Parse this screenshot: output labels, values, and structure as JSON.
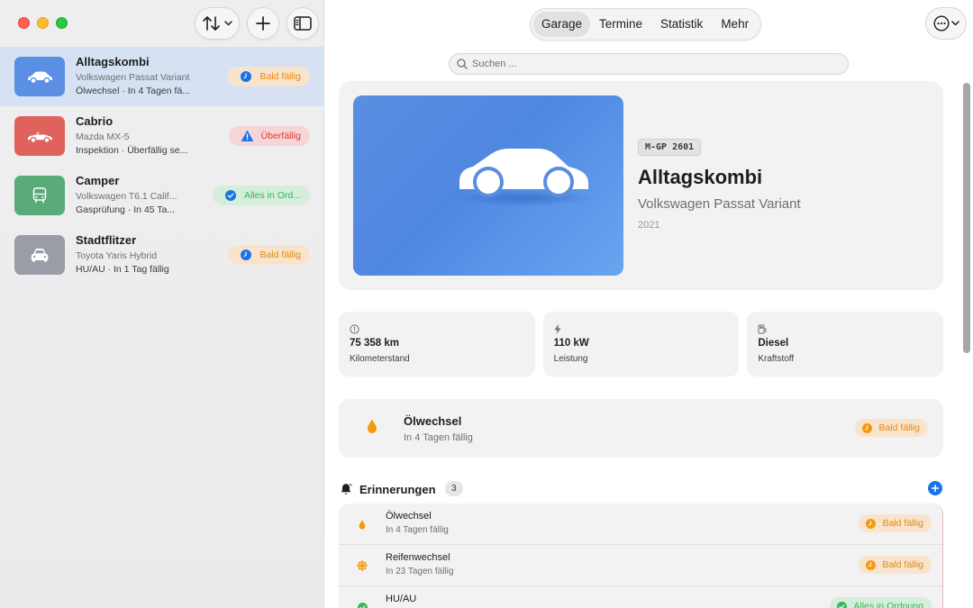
{
  "sidebar": {
    "vehicles": [
      {
        "name": "Alltagskombi",
        "model": "Volkswagen Passat Variant",
        "status": "Ölwechsel · In 4 Tagen fä...",
        "badge": "Bald fällig",
        "badge_type": "soon",
        "thumb_color": "#5b8fe3",
        "icon": "car-icon",
        "active": true
      },
      {
        "name": "Cabrio",
        "model": "Mazda MX-5",
        "status": "Inspektion · Überfällig se...",
        "badge": "Überfällig",
        "badge_type": "over",
        "thumb_color": "#e0625d",
        "icon": "convertible-icon",
        "active": false
      },
      {
        "name": "Camper",
        "model": "Volkswagen T6.1 Calif...",
        "status": "Gasprüfung · In 45 Ta...",
        "badge": "Alles in Ord...",
        "badge_type": "ok",
        "thumb_color": "#5aab78",
        "icon": "bus-icon",
        "active": false
      },
      {
        "name": "Stadtflitzer",
        "model": "Toyota Yaris Hybrid",
        "status": "HU/AU · In 1 Tag fällig",
        "badge": "Bald fällig",
        "badge_type": "soon",
        "thumb_color": "#9a9ca6",
        "icon": "car-front-icon",
        "active": false
      }
    ]
  },
  "toolbar": {
    "tabs": [
      "Garage",
      "Termine",
      "Statistik",
      "Mehr"
    ],
    "active_tab": "Garage",
    "search_placeholder": "Suchen ..."
  },
  "detail": {
    "plate": "M-GP 2601",
    "name": "Alltagskombi",
    "model": "Volkswagen Passat Variant",
    "year": "2021",
    "stats": [
      {
        "value": "75 358 km",
        "label": "Kilometerstand",
        "icon": "gauge-icon"
      },
      {
        "value": "110 kW",
        "label": "Leistung",
        "icon": "bolt-icon"
      },
      {
        "value": "Diesel",
        "label": "Kraftstoff",
        "icon": "fuel-icon"
      }
    ],
    "next_service": {
      "title": "Ölwechsel",
      "subtitle": "In 4 Tagen fällig",
      "badge": "Bald fällig"
    }
  },
  "reminders": {
    "title": "Erinnerungen",
    "count": "3",
    "items": [
      {
        "title": "Ölwechsel",
        "subtitle": "In 4 Tagen fällig",
        "badge": "Bald fällig",
        "badge_type": "soon",
        "icon": "drop-icon"
      },
      {
        "title": "Reifenwechsel",
        "subtitle": "In 23 Tagen fällig",
        "badge": "Bald fällig",
        "badge_type": "soon",
        "icon": "snowflake-icon"
      },
      {
        "title": "HU/AU",
        "subtitle": "",
        "badge": "Alles in Ordnung",
        "badge_type": "ok",
        "icon": "check-icon"
      }
    ]
  },
  "colors": {
    "accent": "#1a73e8",
    "soon": "#e8870f",
    "over": "#e0372d",
    "ok": "#34b85a"
  }
}
